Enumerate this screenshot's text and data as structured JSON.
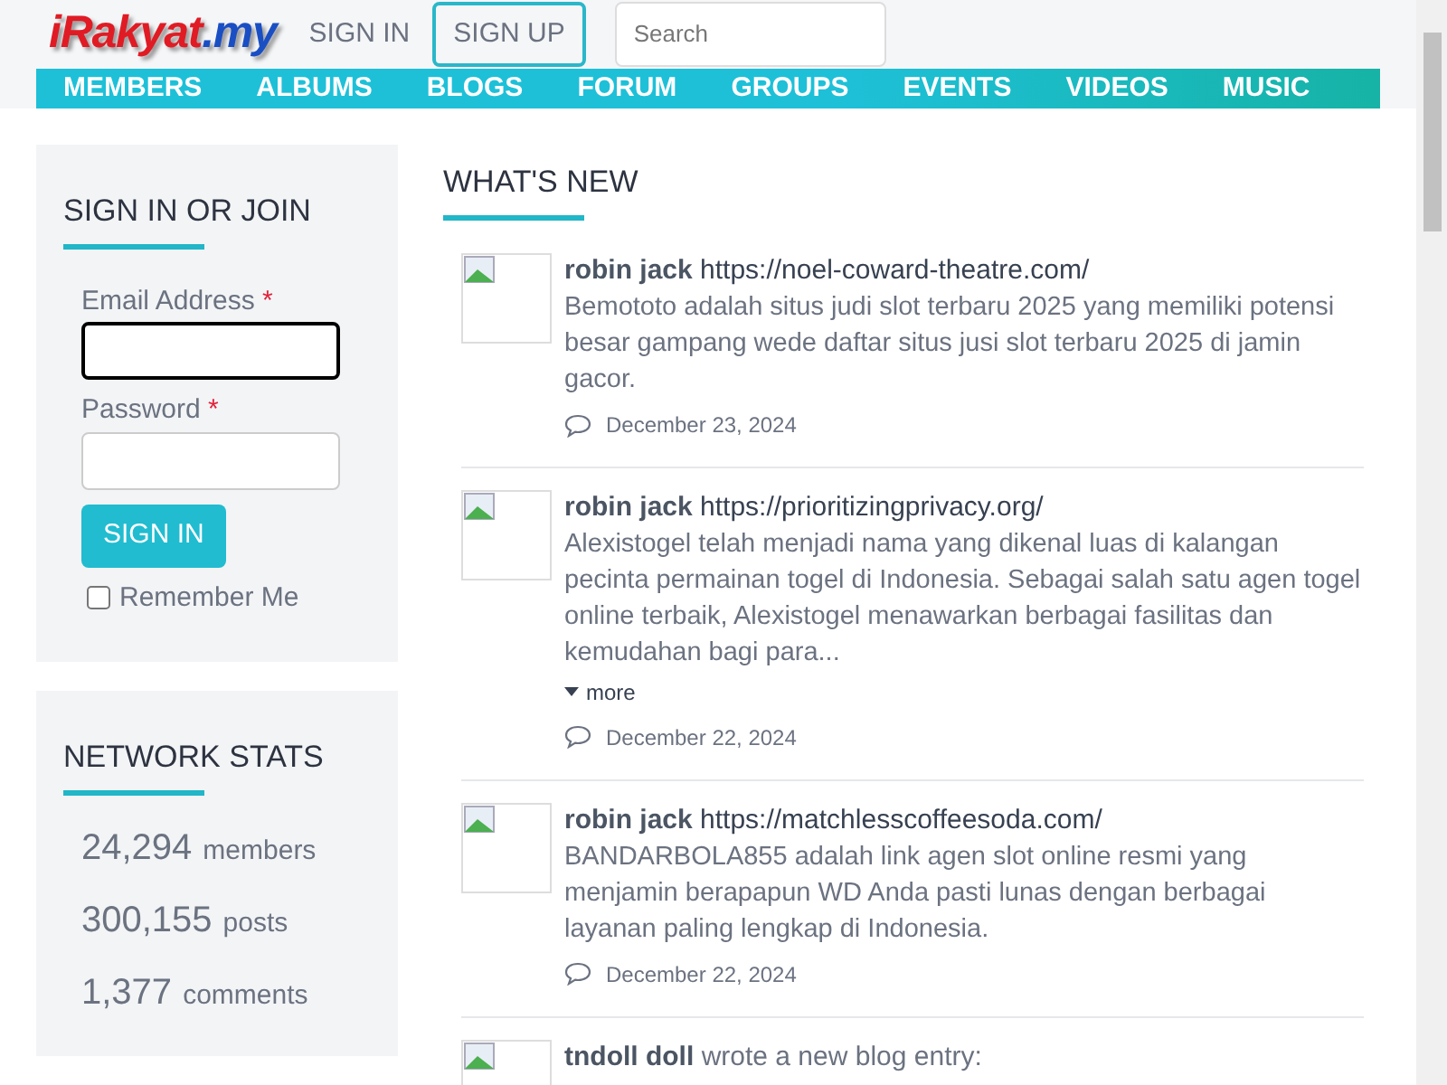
{
  "header": {
    "logo": {
      "main": "iRakyat",
      "suffix": ".my"
    },
    "sign_in": "SIGN IN",
    "sign_up": "SIGN UP",
    "search": {
      "placeholder": "Search"
    }
  },
  "nav": {
    "items": [
      {
        "label": "MEMBERS"
      },
      {
        "label": "ALBUMS"
      },
      {
        "label": "BLOGS"
      },
      {
        "label": "FORUM"
      },
      {
        "label": "GROUPS"
      },
      {
        "label": "EVENTS"
      },
      {
        "label": "VIDEOS"
      },
      {
        "label": "MUSIC"
      }
    ]
  },
  "login": {
    "title": "SIGN IN OR JOIN",
    "email_label": "Email Address",
    "password_label": "Password",
    "required_mark": "*",
    "button": "SIGN IN",
    "remember": {
      "label": "Remember Me",
      "checked": false
    }
  },
  "stats": {
    "title": "NETWORK STATS",
    "items": [
      {
        "number": "24,294",
        "label": "members"
      },
      {
        "number": "300,155",
        "label": "posts"
      },
      {
        "number": "1,377",
        "label": "comments"
      }
    ]
  },
  "feed": {
    "title": "WHAT'S NEW",
    "items": [
      {
        "author": "robin jack",
        "link": "https://noel-coward-theatre.com/",
        "text": "Bemototo adalah situs judi slot terbaru 2025 yang memiliki potensi besar gampang wede daftar situs jusi slot terbaru 2025 di jamin gacor.",
        "date": "December 23, 2024"
      },
      {
        "author": "robin jack",
        "link": "https://prioritizingprivacy.org/",
        "text": "Alexistogel telah menjadi nama yang dikenal luas di kalangan pecinta permainan togel di Indonesia. Sebagai salah satu agen togel online terbaik, Alexistogel menawarkan berbagai fasilitas dan kemudahan bagi para...",
        "more": "more",
        "date": "December 22, 2024"
      },
      {
        "author": "robin jack",
        "link": "https://matchlesscoffeesoda.com/",
        "text": "BANDARBOLA855 adalah link agen slot online resmi yang menjamin berapapun WD Anda pasti lunas dengan berbagai layanan paling lengkap di Indonesia.",
        "date": "December 22, 2024"
      },
      {
        "author": "tndoll doll",
        "action": "wrote a new blog entry:"
      }
    ]
  }
}
